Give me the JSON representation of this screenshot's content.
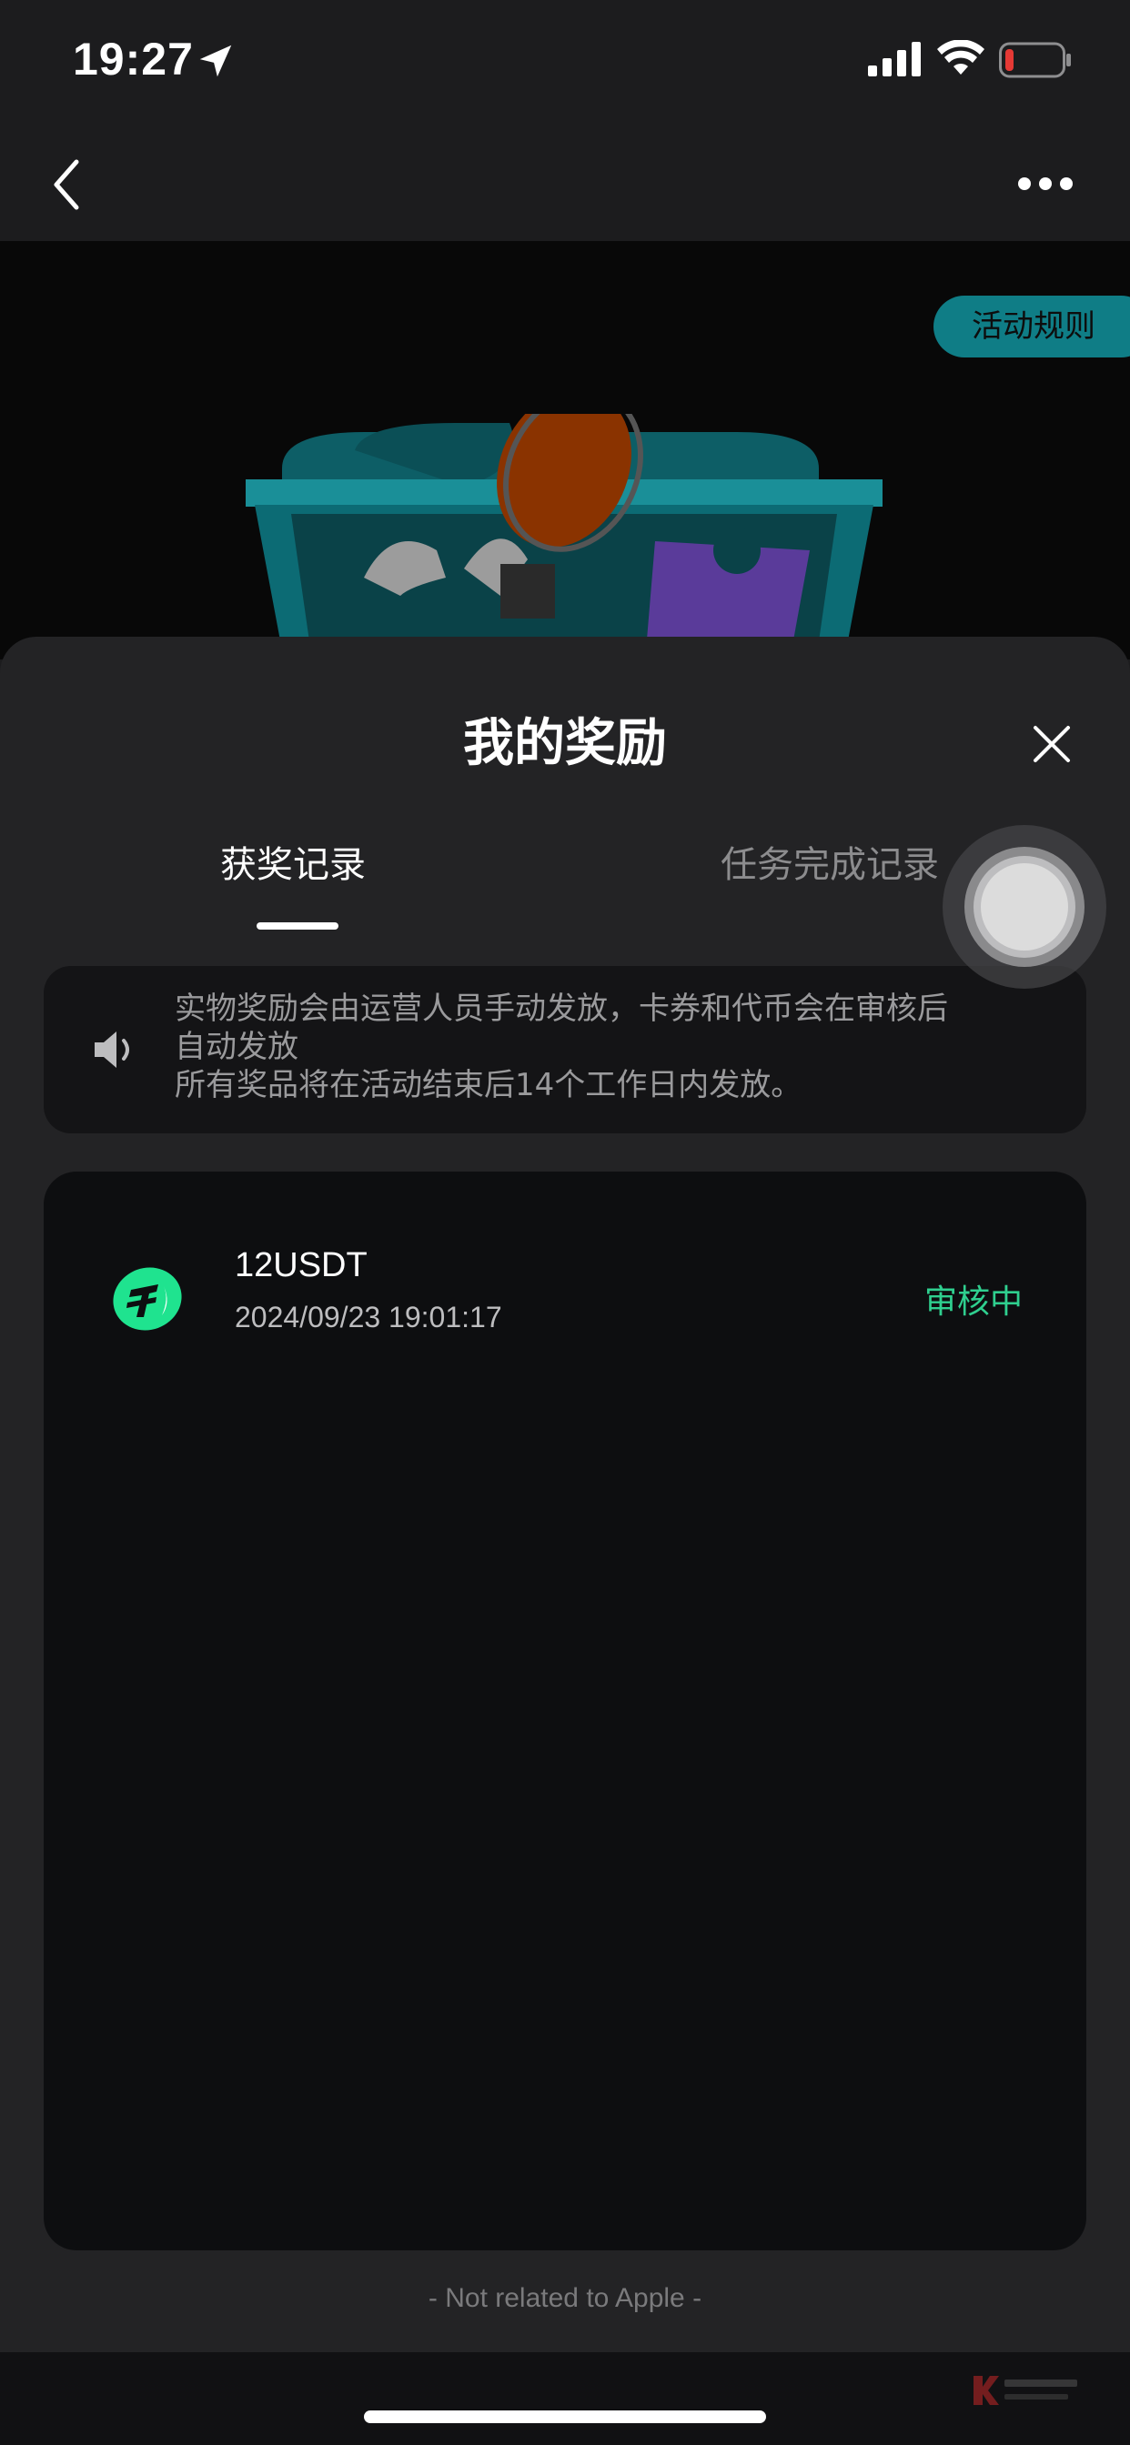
{
  "status_bar": {
    "time": "19:27",
    "battery_color": "#e53935"
  },
  "header": {
    "rules_button": "活动规则"
  },
  "sheet": {
    "title": "我的奖励",
    "tabs": [
      {
        "label": "获奖记录",
        "active": true
      },
      {
        "label": "任务完成记录",
        "active": false
      }
    ],
    "notice_lines": [
      "实物奖励会由运营人员手动发放，卡券和代币会在审核后",
      "自动发放",
      "所有奖品将在活动结束后14个工作日内发放。"
    ],
    "records": [
      {
        "icon": "usdt-coin-icon",
        "amount": "12USDT",
        "time": "2024/09/23 19:01:17",
        "status": "审核中"
      }
    ],
    "footer_note": "- Not related to Apple -"
  },
  "colors": {
    "accent_teal": "#0f7d86",
    "status_green": "#2fcf8f",
    "usdt_green": "#1fe38f"
  }
}
